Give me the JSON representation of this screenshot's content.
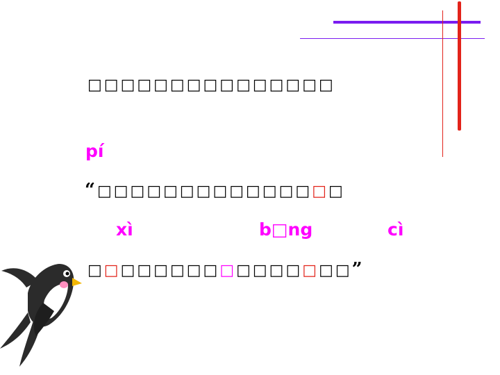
{
  "colors": {
    "purple": "#7a1cf0",
    "red": "#e2231a",
    "magenta": "#ff00ff",
    "text": "#000000"
  },
  "lines": {
    "title": "□□□□□□□□□□□□□□□",
    "pinyin_1": "pí",
    "quote_open": "“",
    "quote_1_plain": "□□□□□□□□□□□□□",
    "quote_1_highlight": "□",
    "quote_1_tail": "□",
    "pinyin_2a": "xì",
    "pinyin_2b": "b□ng",
    "pinyin_2c": "cì",
    "quote_2_a": "□",
    "quote_2_b": "□",
    "quote_2_c": "□□□□□□",
    "quote_2_d": "□",
    "quote_2_e": "□□□□",
    "quote_2_f": "□",
    "quote_2_g": "□□",
    "quote_close": "”"
  },
  "decoration": {
    "bird_icon": "swallow-bird-icon"
  }
}
